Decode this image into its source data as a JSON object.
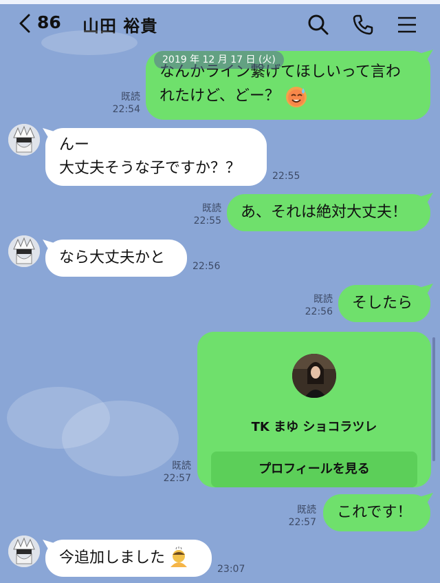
{
  "header": {
    "unread_count": "86",
    "title": "山田 裕貴"
  },
  "date_label": "2019 年 12 月 17 日 (火)",
  "messages": [
    {
      "side": "sent",
      "lines": [
        "なんかライン繋げてほしいって言わ",
        "れたけど、どー？"
      ],
      "read": "既読",
      "time": "22:54",
      "emoji": "sweat-smile-face"
    },
    {
      "side": "recv",
      "lines": [
        "んー",
        "大丈夫そうな子ですか？？"
      ],
      "time": "22:55"
    },
    {
      "side": "sent",
      "lines": [
        "あ、それは絶対大丈夫！"
      ],
      "read": "既読",
      "time": "22:55"
    },
    {
      "side": "recv",
      "lines": [
        "なら大丈夫かと"
      ],
      "time": "22:56"
    },
    {
      "side": "sent",
      "lines": [
        "そしたら"
      ],
      "read": "既読",
      "time": "22:56"
    },
    {
      "side": "sent",
      "lines": [
        "これです！"
      ],
      "read": "既読",
      "time": "22:57"
    },
    {
      "side": "recv",
      "lines": [
        "今追加しました"
      ],
      "time": "23:07",
      "emoji": "bowing-person"
    }
  ],
  "contact_card": {
    "name": "TK まゆ ショコラツレ",
    "button_label": "プロフィールを見る",
    "read": "既読",
    "time": "22:57"
  },
  "colors": {
    "background": "#8aa6d6",
    "sent_bubble": "#6fe06c",
    "recv_bubble": "#ffffff"
  },
  "icons": [
    "back-chevron-icon",
    "search-icon",
    "phone-icon",
    "menu-icon"
  ]
}
